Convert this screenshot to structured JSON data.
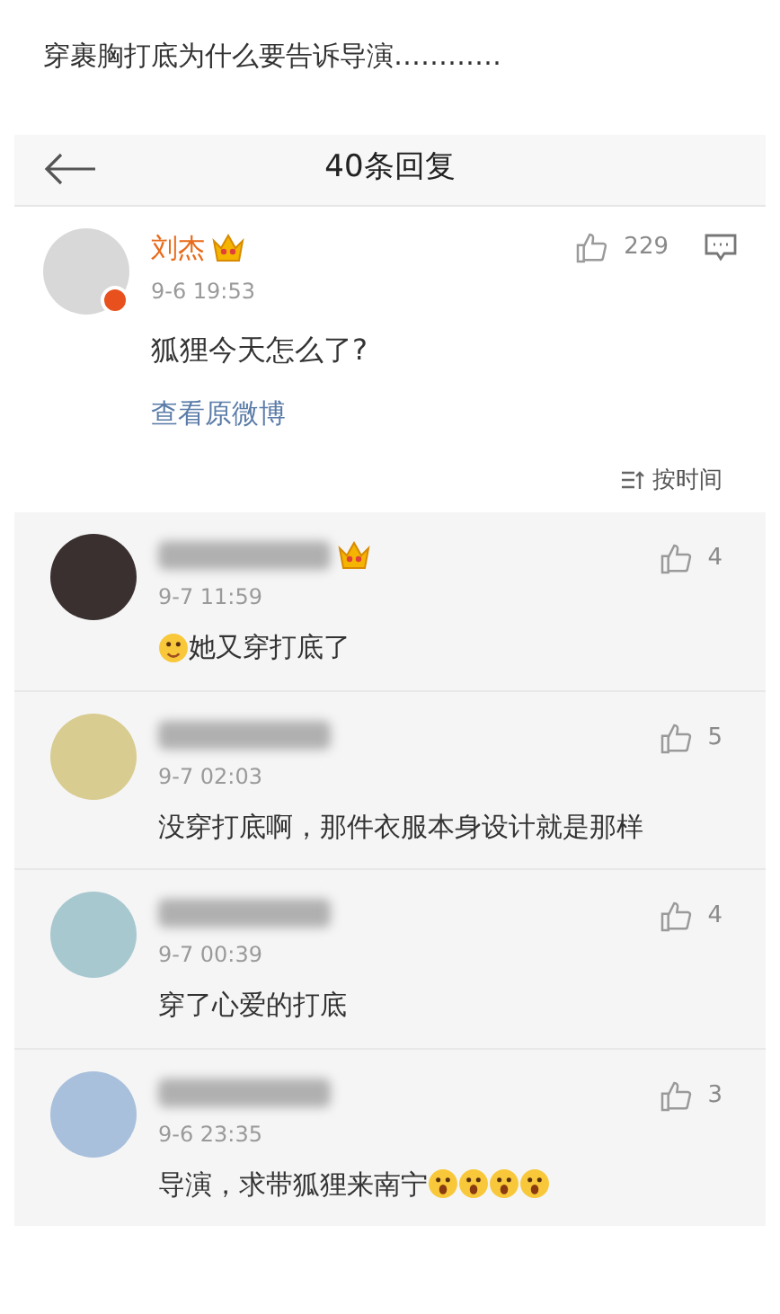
{
  "headline": "穿裹胸打底为什么要告诉导演…………",
  "header": {
    "title": "40条回复"
  },
  "post": {
    "author": "刘杰",
    "crown": true,
    "verified": true,
    "time": "9-6 19:53",
    "likes": "229",
    "text": "狐狸今天怎么了?",
    "link": "查看原微博",
    "sort": "按时间"
  },
  "comments": [
    {
      "color": "#3a3030",
      "crown": true,
      "time": "9-7 11:59",
      "likes": "4",
      "emojis_before": [
        {
          "kind": "smirk"
        }
      ],
      "text": "她又穿打底了"
    },
    {
      "color": "#d8cc90",
      "crown": false,
      "time": "9-7 02:03",
      "likes": "5",
      "text": "没穿打底啊，那件衣服本身设计就是那样"
    },
    {
      "color": "#a8c8d0",
      "crown": false,
      "time": "9-7 00:39",
      "likes": "4",
      "text": "穿了心爱的打底"
    },
    {
      "color": "#a8c0dc",
      "crown": false,
      "time": "9-6 23:35",
      "likes": "3",
      "text": "导演，求带狐狸来南宁",
      "emojis_after": [
        {
          "kind": "shock"
        },
        {
          "kind": "shock"
        },
        {
          "kind": "shock"
        },
        {
          "kind": "shock"
        }
      ]
    }
  ]
}
